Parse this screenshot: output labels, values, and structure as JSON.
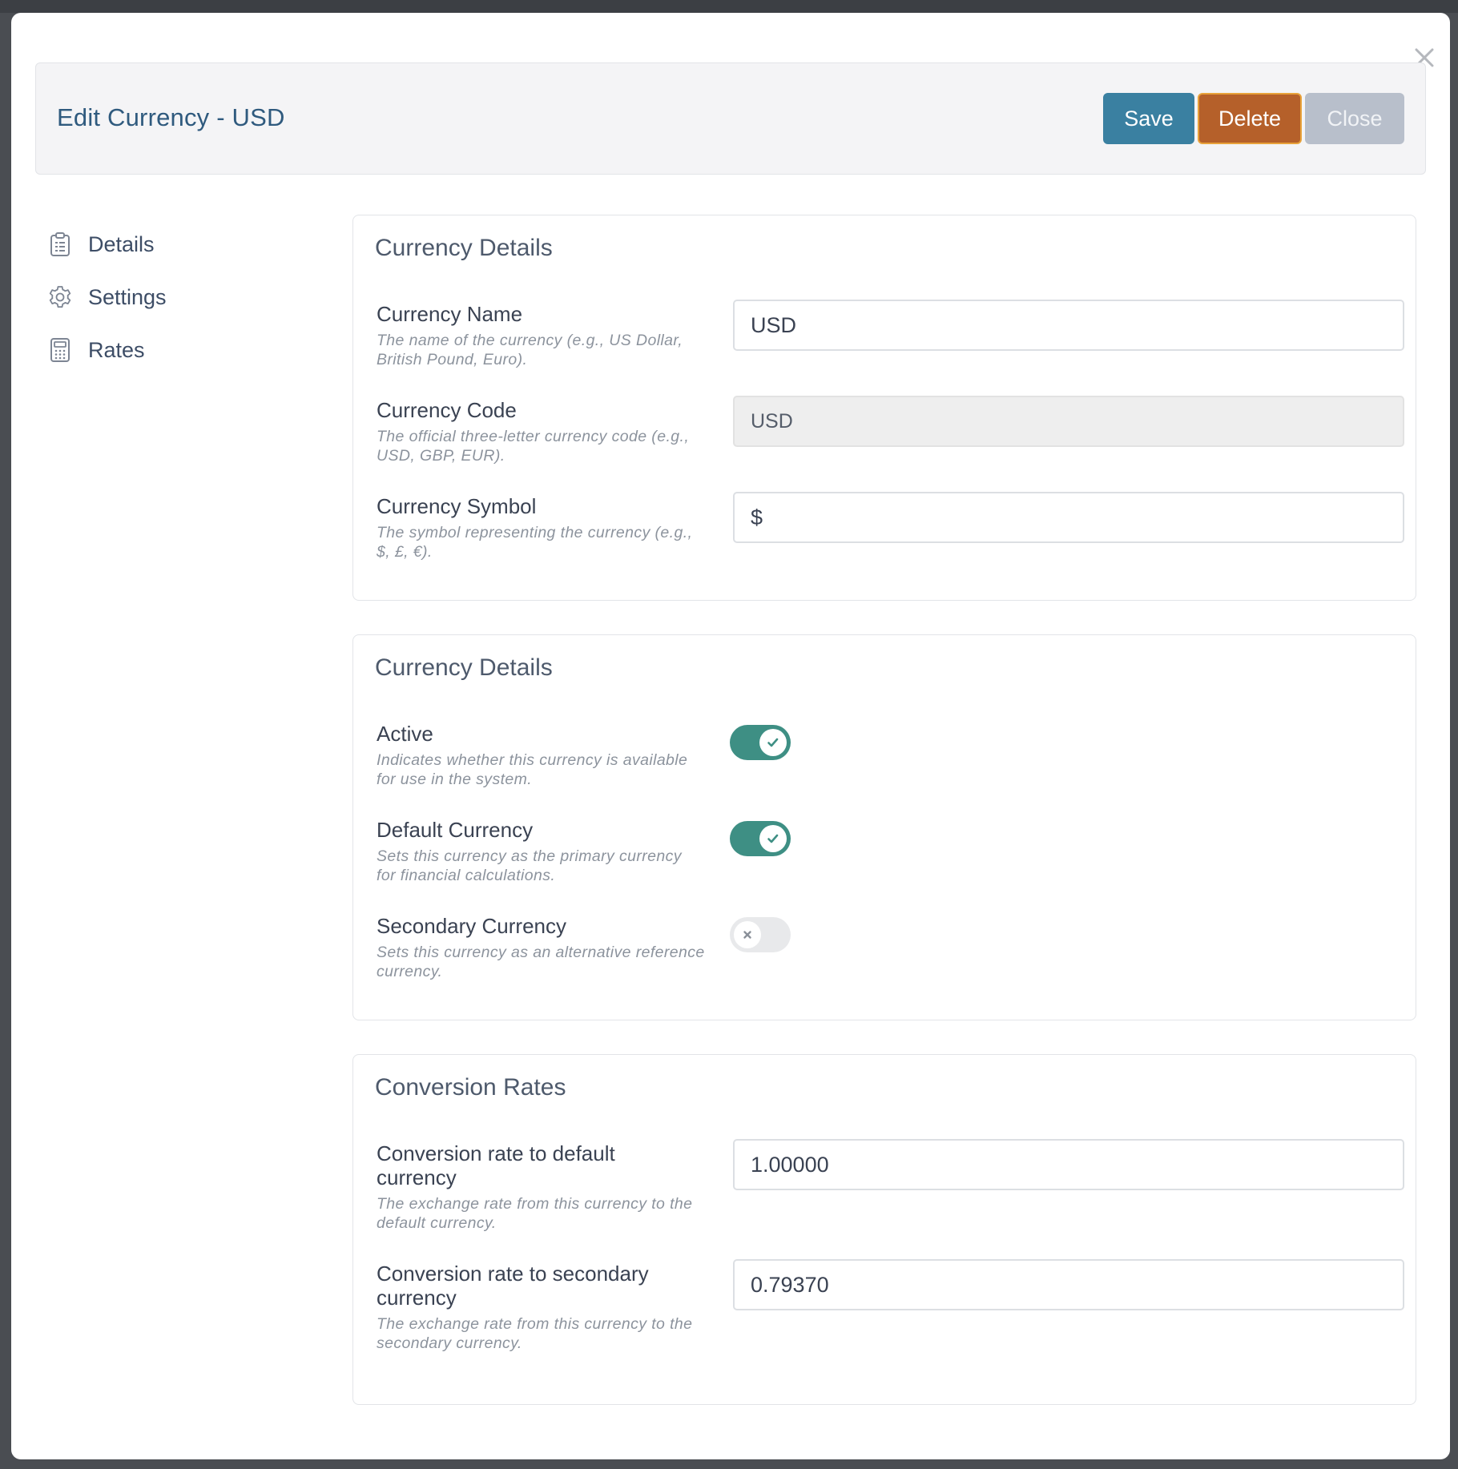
{
  "header": {
    "title": "Edit Currency - USD",
    "save_label": "Save",
    "delete_label": "Delete",
    "close_label": "Close"
  },
  "colors": {
    "title": "#2f5a7e",
    "save": "#3a80a1",
    "delete": "#b5602a",
    "close": "#b8bfcb",
    "toggle_on": "#3e8f84"
  },
  "nav": {
    "items": [
      {
        "label": "Details",
        "icon": "clipboard-icon"
      },
      {
        "label": "Settings",
        "icon": "gear-icon"
      },
      {
        "label": "Rates",
        "icon": "calculator-icon"
      }
    ]
  },
  "details_card": {
    "title": "Currency Details",
    "name": {
      "label": "Currency Name",
      "help": "The name of the currency (e.g., US Dollar, British Pound, Euro).",
      "value": "USD"
    },
    "code": {
      "label": "Currency Code",
      "help": "The official three-letter currency code (e.g., USD, GBP, EUR).",
      "value": "USD"
    },
    "symbol": {
      "label": "Currency Symbol",
      "help": "The symbol representing the currency (e.g., $, £, €).",
      "value": "$"
    }
  },
  "settings_card": {
    "title": "Currency Details",
    "active": {
      "label": "Active",
      "help": "Indicates whether this currency is available for use in the system.",
      "on": true
    },
    "default": {
      "label": "Default Currency",
      "help": "Sets this currency as the primary currency for financial calculations.",
      "on": true
    },
    "secondary": {
      "label": "Secondary Currency",
      "help": "Sets this currency as an alternative reference currency.",
      "on": false
    }
  },
  "rates_card": {
    "title": "Conversion Rates",
    "to_default": {
      "label": "Conversion rate to default currency",
      "help": "The exchange rate from this currency to the default currency.",
      "value": "1.00000"
    },
    "to_secondary": {
      "label": "Conversion rate to secondary currency",
      "help": "The exchange rate from this currency to the secondary currency.",
      "value": "0.79370"
    }
  }
}
